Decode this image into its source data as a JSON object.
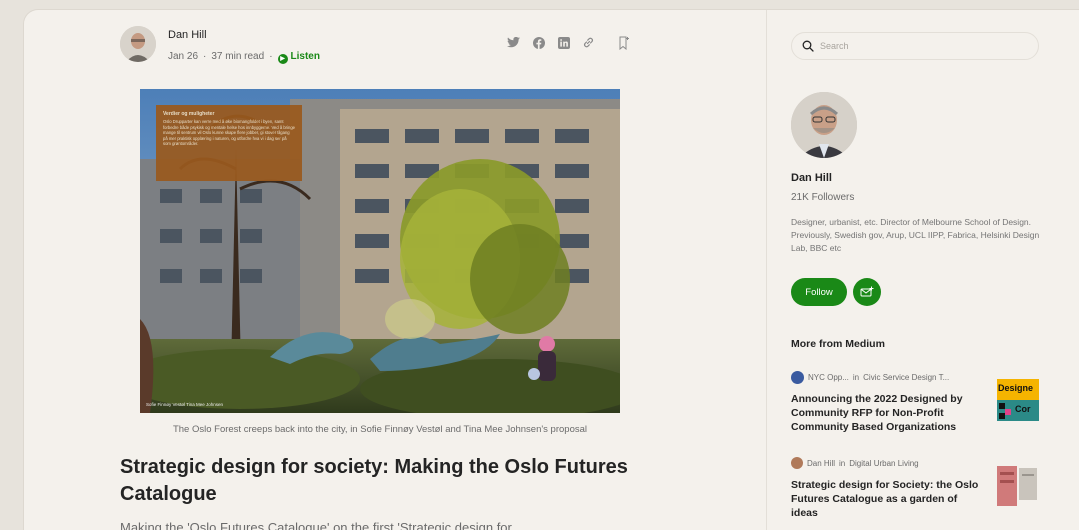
{
  "article": {
    "author_name": "Dan Hill",
    "date": "Jan 26",
    "read_time": "37 min read",
    "listen_label": "Listen",
    "share_icons": [
      "twitter-icon",
      "facebook-icon",
      "linkedin-icon",
      "link-icon",
      "bookmark-icon"
    ],
    "image_overlay": {
      "heading": "Verdier og muligheter",
      "body": "Oslo Drupparter kan verre med å øke biomangfoldet i byen, samt forbedre både psykisk og mentale helse hos innbyggerne. Ved å bringe mange til sentrum vil Oslo kunne skape flere jobber, gi stover tilgang på mer praktisk opplæring i naturen, og utfordre hva vi i dag ser på som grøntområder."
    },
    "image_credit": "Sofie Finnøy Vestøl Tina Mee Johnsen",
    "caption": "The Oslo Forest creeps back into the city, in Sofie Finnøy Vestøl and Tina Mee Johnsen's proposal",
    "title": "Strategic design for society: Making the Oslo Futures Catalogue",
    "subtitle": "Making the 'Oslo Futures Catalogue' on the first 'Strategic design for"
  },
  "sidebar": {
    "search_placeholder": "Search",
    "profile": {
      "name": "Dan Hill",
      "followers": "21K Followers",
      "bio": "Designer, urbanist, etc. Director of Melbourne School of Design. Previously, Swedish gov, Arup, UCL IIPP, Fabrica, Helsinki Design Lab, BBC etc",
      "follow_label": "Follow"
    },
    "more_heading": "More from Medium",
    "recommendations": [
      {
        "author": "NYC Opp...",
        "in_label": "in",
        "publication": "Civic Service Design T...",
        "title": "Announcing the 2022 Designed by Community RFP for Non-Profit Community Based Organizations",
        "thumb_text_top": "Designe",
        "thumb_text_bottom": "Cor"
      },
      {
        "author": "Dan Hill",
        "in_label": "in",
        "publication": "Digital Urban Living",
        "title": "Strategic design for Society: the Oslo Futures Catalogue as a garden of ideas"
      }
    ]
  },
  "colors": {
    "accent_green": "#1a8917",
    "page_bg": "#f4f1ec",
    "text_primary": "#242424",
    "text_secondary": "#6b6b6b",
    "overlay_box": "#9a5a1e"
  }
}
